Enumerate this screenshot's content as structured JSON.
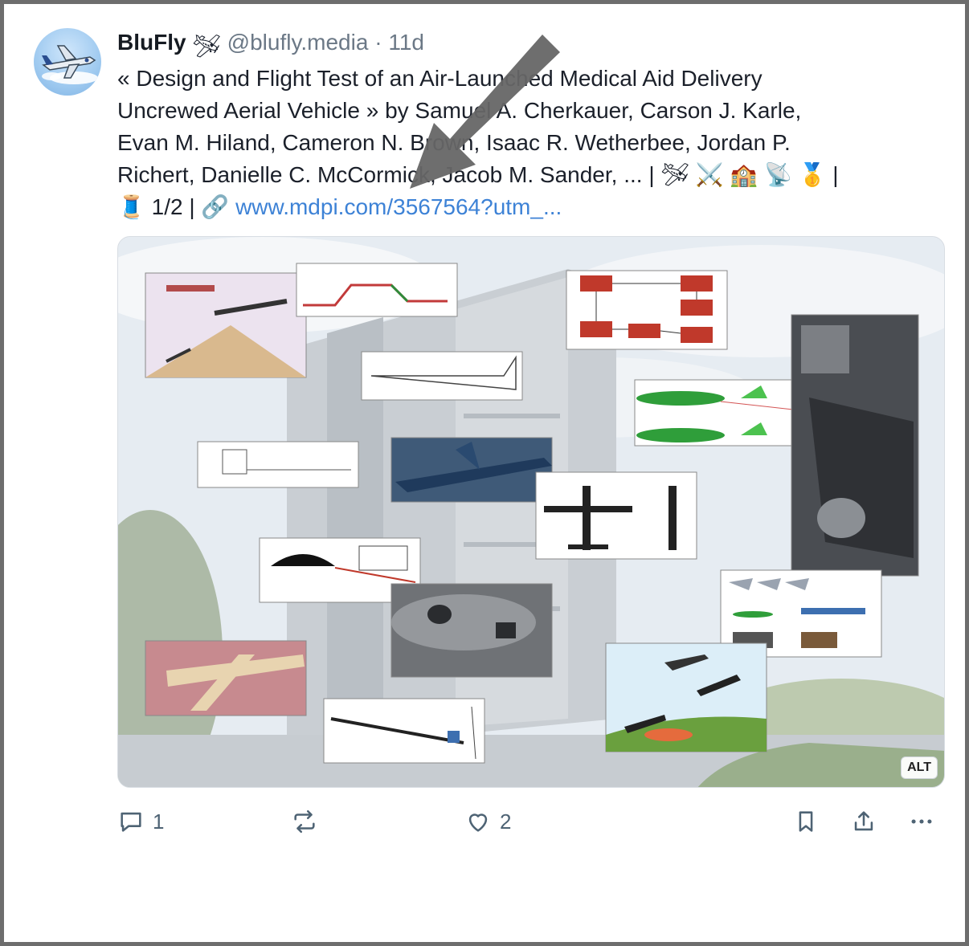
{
  "post": {
    "author_name": "BluFly",
    "author_emoji": "🛩",
    "handle": "@blufly.media",
    "separator": "·",
    "time": "11d",
    "text_lines": [
      "« Design and Flight Test of an Air-Launched Medical Aid Delivery",
      "Uncrewed Aerial Vehicle » by Samuel A. Cherkauer, Carson J. Karle,",
      "Evan M. Hiland, Cameron N. Brown, Isaac R. Wetherbee, Jordan P.",
      "Richert, Danielle C. McCormick, Jacob M. Sander, ... | 🛩 ⚔️ 🏫 📡 🥇 |"
    ],
    "thread_emoji": "🧵",
    "thread_count": "1/2 |",
    "link_emoji": "🔗",
    "link_text": "www.mdpi.com/3567564?utm_...",
    "media_alt_badge": "ALT"
  },
  "actions": {
    "reply_count": "1",
    "repost_count": "",
    "like_count": "2"
  },
  "colors": {
    "link": "#3d82d6",
    "muted": "#6b7886",
    "icon": "#4e6374",
    "frame": "#6d6d6d"
  },
  "icons": [
    "avatar-jet-icon",
    "reply-icon",
    "repost-icon",
    "like-icon",
    "bookmark-icon",
    "share-icon",
    "more-icon",
    "annotation-arrow"
  ]
}
